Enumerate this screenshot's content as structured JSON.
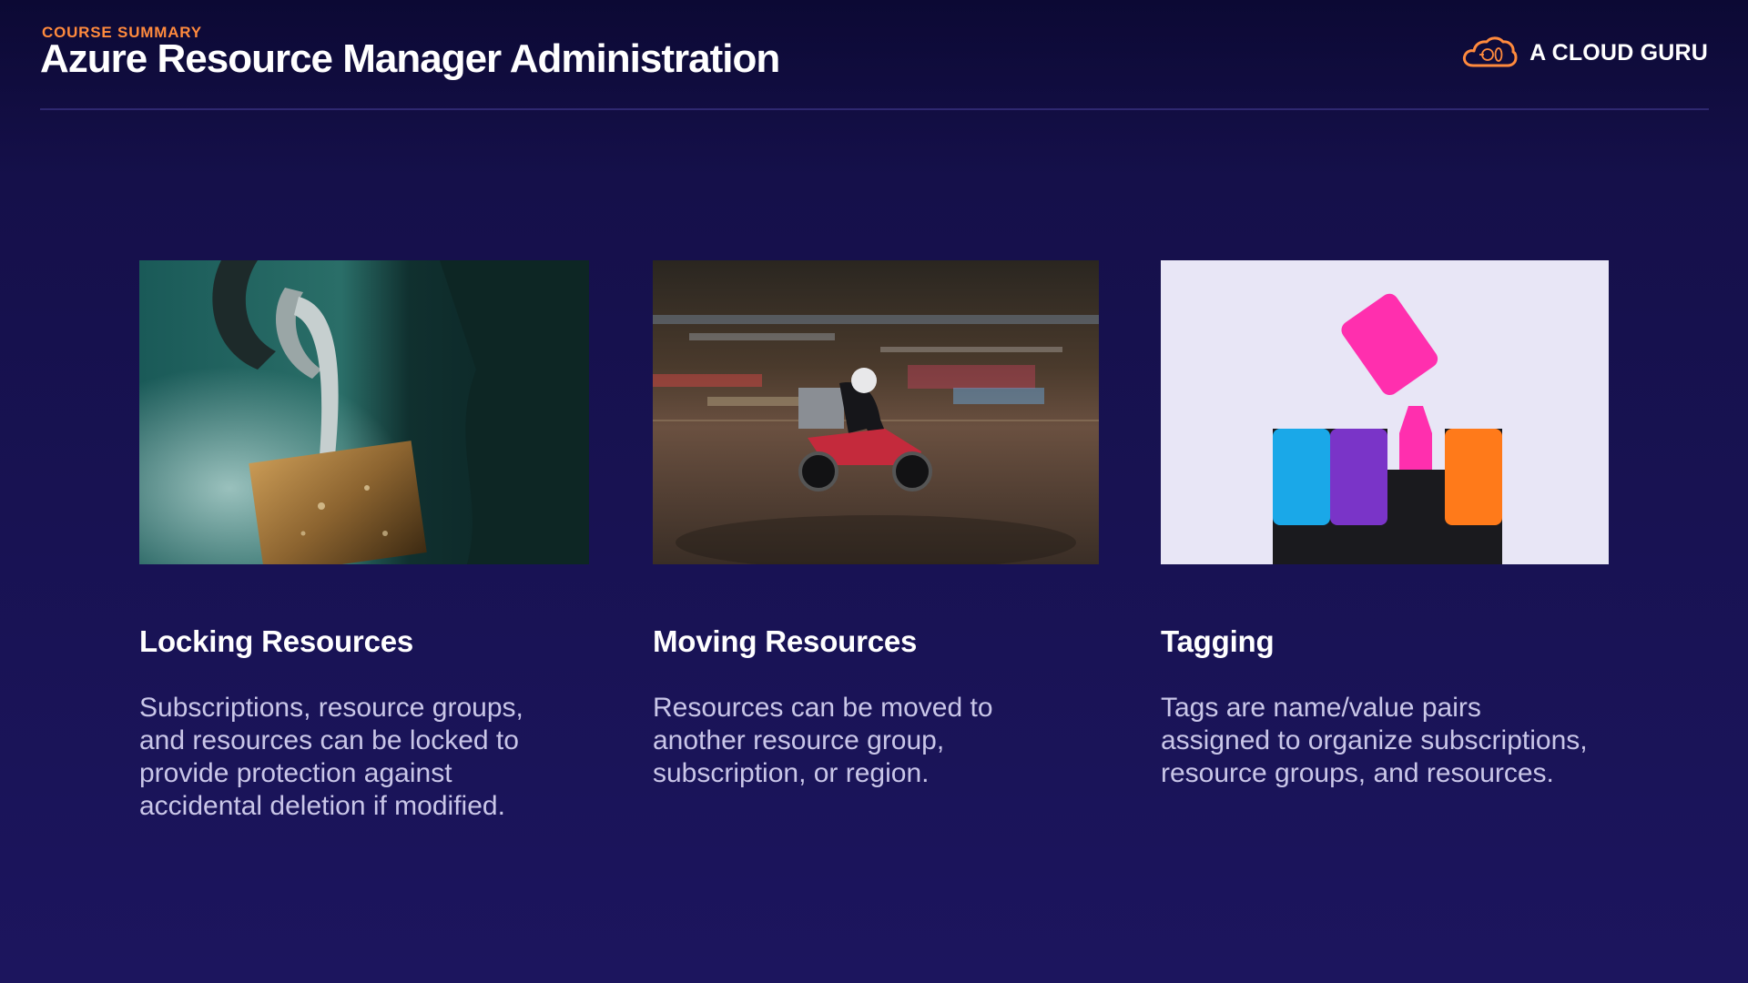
{
  "header": {
    "eyebrow": "COURSE SUMMARY",
    "title": "Azure Resource Manager Administration"
  },
  "brand": {
    "name": "A CLOUD GURU",
    "logo_icon": "cloud-logo-icon",
    "accent_color": "#ff8a3d"
  },
  "cards": [
    {
      "image": "padlock-photo",
      "title": "Locking Resources",
      "lines": [
        "Subscriptions, resource groups,",
        "and resources can be locked to",
        "provide protection against",
        "accidental deletion if modified."
      ]
    },
    {
      "image": "scooter-rider-photo",
      "title": "Moving Resources",
      "lines": [
        "Resources can be moved to",
        "another resource group,",
        "subscription, or region."
      ]
    },
    {
      "image": "highlighter-markers-photo",
      "title": "Tagging",
      "lines": [
        "Tags are name/value pairs",
        "assigned to organize subscriptions,",
        "resource groups, and resources."
      ]
    }
  ],
  "colors": {
    "background": "#15104a",
    "title_text": "#ffffff",
    "body_text": "#c9c6e8"
  }
}
